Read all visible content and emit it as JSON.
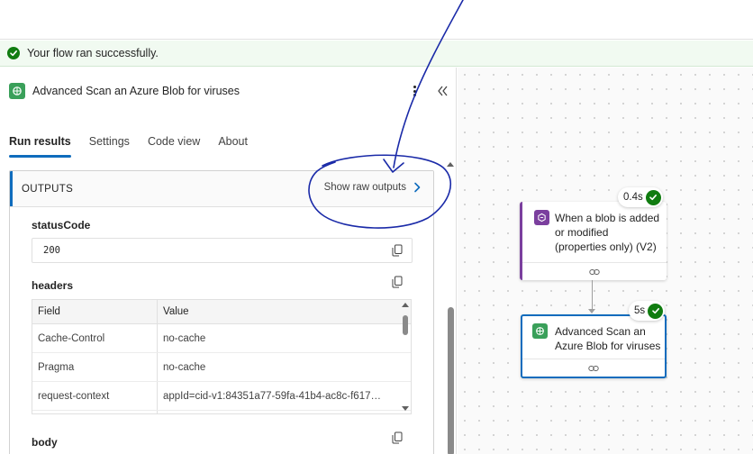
{
  "banner": {
    "message": "Your flow ran successfully."
  },
  "panel": {
    "title": "Advanced Scan an Azure Blob for viruses",
    "tabs": [
      {
        "label": "Run results",
        "active": true
      },
      {
        "label": "Settings"
      },
      {
        "label": "Code view"
      },
      {
        "label": "About"
      }
    ]
  },
  "outputs": {
    "section_label": "OUTPUTS",
    "raw_button": "Show raw outputs",
    "status_code_label": "statusCode",
    "status_code_value": "200",
    "headers_label": "headers",
    "headers_columns": {
      "field": "Field",
      "value": "Value"
    },
    "headers_rows": [
      {
        "field": "Cache-Control",
        "value": "no-cache"
      },
      {
        "field": "Pragma",
        "value": "no-cache"
      },
      {
        "field": "request-context",
        "value": "appId=cid-v1:84351a77-59fa-41b4-ac8c-f617…"
      }
    ],
    "body_label": "body"
  },
  "canvas": {
    "trigger": {
      "label_lines": [
        "When a blob is added",
        "or modified",
        "(properties only) (V2)"
      ],
      "duration": "0.4s"
    },
    "action": {
      "label_lines": [
        "Advanced Scan an",
        "Azure Blob for viruses"
      ],
      "duration": "5s"
    }
  },
  "colors": {
    "success": "#107c10",
    "accent": "#0f6cbd",
    "action_icon": "#3aa05a",
    "trigger_icon": "#7b3f9e",
    "annotation": "#1a2aa8"
  },
  "icons": {
    "banner": "check-circle-icon",
    "panel": "action-icon",
    "more": "more-vertical-icon",
    "collapse": "double-chevron-left-icon",
    "raw": "chevron-right-icon",
    "copy": "copy-icon",
    "link": "link-icon",
    "trigger": "blob-trigger-icon"
  }
}
